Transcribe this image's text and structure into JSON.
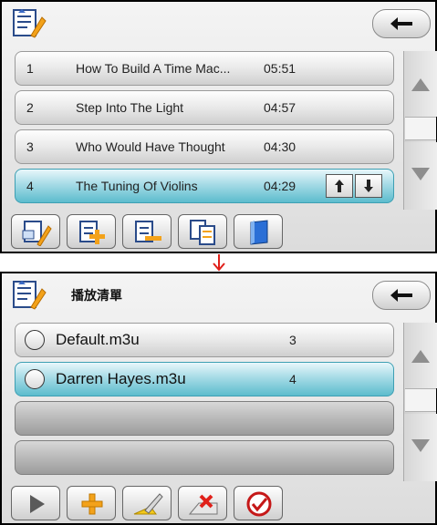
{
  "screen1": {
    "title": "",
    "tracks": [
      {
        "num": "1",
        "title": "How To Build A Time Mac...",
        "duration": "05:51"
      },
      {
        "num": "2",
        "title": "Step Into The Light",
        "duration": "04:57"
      },
      {
        "num": "3",
        "title": "Who Would Have Thought",
        "duration": "04:30"
      },
      {
        "num": "4",
        "title": "The Tuning Of Violins",
        "duration": "04:29"
      }
    ],
    "selected_index": 3,
    "toolbar_icons": [
      "edit-playlist-icon",
      "add-track-icon",
      "remove-track-icon",
      "copy-track-icon",
      "save-icon"
    ]
  },
  "screen2": {
    "title": "播放清單",
    "playlists": [
      {
        "name": "Default.m3u",
        "count": "3"
      },
      {
        "name": "Darren Hayes.m3u",
        "count": "4"
      }
    ],
    "selected_index": 1,
    "toolbar_icons": [
      "play-icon",
      "add-icon",
      "edit-icon",
      "delete-icon",
      "confirm-icon"
    ]
  },
  "colors": {
    "selection": "#5cbccd",
    "accent_red": "#e0201a",
    "accent_orange": "#f3a21a"
  }
}
